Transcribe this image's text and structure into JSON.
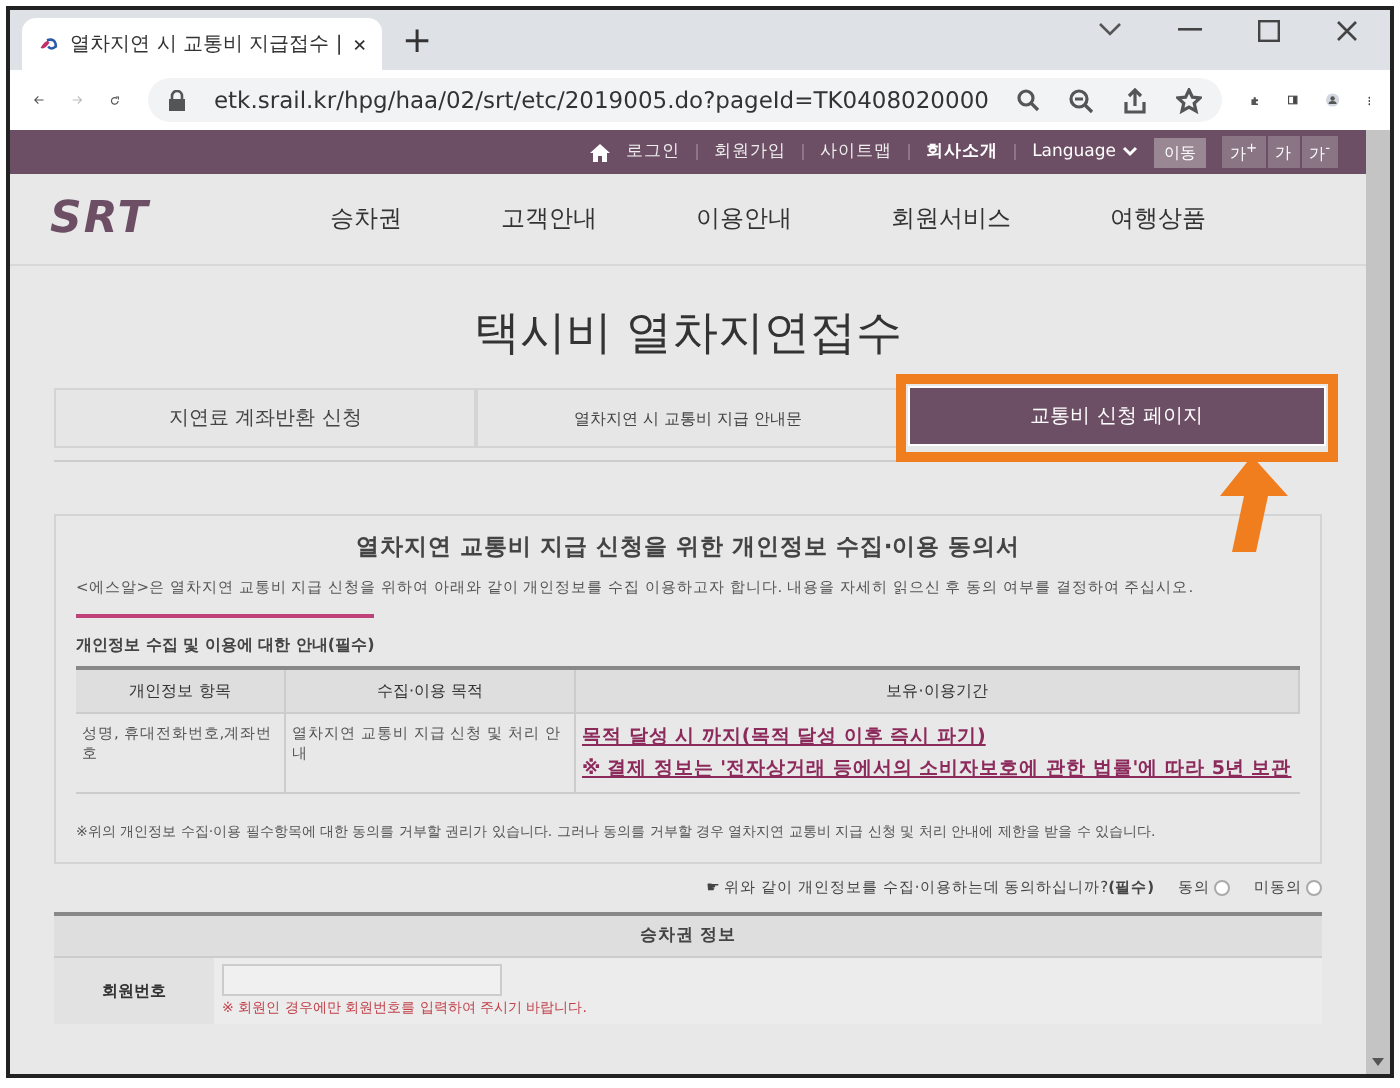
{
  "browser": {
    "tab_title": "열차지연 시 교통비 지급접수 | ",
    "new_tab": "+",
    "url": "etk.srail.kr/hpg/haa/02/srt/etc/2019005.do?pageId=TK0408020000"
  },
  "utility_bar": {
    "links": [
      {
        "label": "로그인",
        "emphasized": false
      },
      {
        "label": "회원가입",
        "emphasized": false
      },
      {
        "label": "사이트맵",
        "emphasized": false
      },
      {
        "label": "회사소개",
        "emphasized": true
      }
    ],
    "language": "Language",
    "go_button": "이동",
    "font_buttons": [
      "가$^{+}$",
      "가",
      "가$^{-}$"
    ]
  },
  "header": {
    "logo": "SRT",
    "nav": [
      "승차권",
      "고객안내",
      "이용안내",
      "회원서비스",
      "여행상품"
    ]
  },
  "page_title": "택시비 열차지연접수",
  "tabs": [
    {
      "label": "지연료 계좌반환 신청",
      "selected": false,
      "highlighted": false
    },
    {
      "label": "열차지연 시 교통비 지급 안내문",
      "selected": false,
      "highlighted": false
    },
    {
      "label": "교통비 신청 페이지",
      "selected": true,
      "highlighted": true
    }
  ],
  "consent": {
    "title": "열차지연 교통비 지급 신청을 위한 개인정보 수집·이용 동의서",
    "intro": "<에스알>은 열차지연 교통비 지급 신청을 위하여 아래와 같이 개인정보를 수집 이용하고자 합니다. 내용을 자세히 읽으신 후 동의 여부를 결정하여 주십시오.",
    "section_heading": "개인정보 수집 및 이용에 대한 안내(필수)",
    "table": {
      "columns": [
        "개인정보 항목",
        "수집·이용 목적",
        "보유·이용기간"
      ],
      "row": {
        "items": "성명, 휴대전화번호,계좌번호",
        "purpose": "열차지연 교통비 지급 신청 및 처리 안내",
        "retention": [
          "목적 달성 시 까지(목적 달성 이후 즉시 파기)",
          "※ 결제 정보는 '전자상거래 등에서의 소비자보호에 관한 법률'에 따라 5년 보관"
        ]
      }
    },
    "notice": "※위의 개인정보 수집·이용 필수항목에 대한 동의를 거부할 권리가 있습니다. 그러나 동의를 거부할 경우 열차지연 교통비 지급 신청 및 처리 안내에 제한을 받을 수 있습니다."
  },
  "agreement": {
    "question": "☛ 위와 같이 개인정보를 수집·이용하는데 동의하십니까?**(필수)**",
    "options": [
      {
        "label": "동의",
        "selected": false
      },
      {
        "label": "미동의",
        "selected": false
      }
    ]
  },
  "ticket_info": {
    "header": "승차권 정보",
    "field_label": "회원번호",
    "hint": "※ 회원인 경우에만 회원번호를 입력하여 주시기 바랍니다."
  }
}
